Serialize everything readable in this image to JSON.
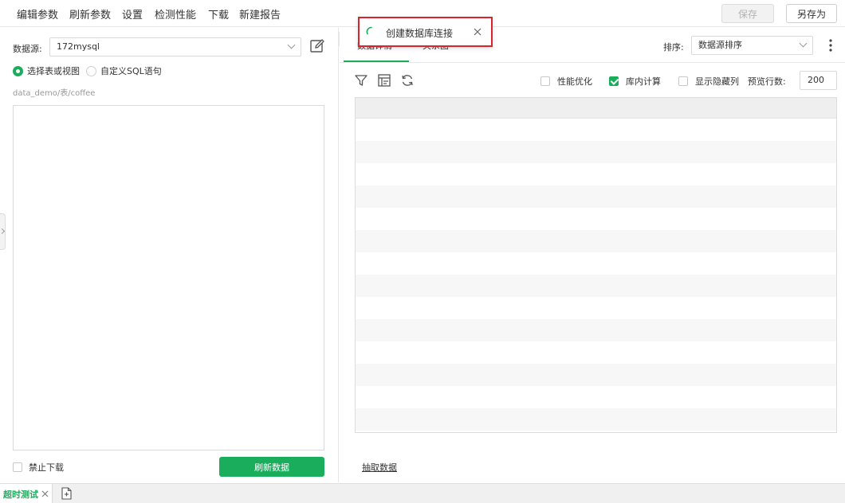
{
  "menu": {
    "items": [
      "编辑参数",
      "刷新参数",
      "设置",
      "检测性能",
      "下载",
      "新建报告"
    ],
    "save_label": "保存",
    "save_as_label": "另存为"
  },
  "left": {
    "datasource_label": "数据源:",
    "datasource_value": "172mysql",
    "radio_table": "选择表或视图",
    "radio_sql": "自定义SQL语句",
    "path": "data_demo/表/coffee",
    "disable_download": "禁止下载",
    "refresh_button": "刷新数据"
  },
  "right": {
    "tab_data": "数据详情",
    "tab_relation": "关系图",
    "sort_label": "排序:",
    "sort_value": "数据源排序",
    "opt_perf": "性能优化",
    "opt_db_calc": "库内计算",
    "opt_show_hidden": "显示隐藏列",
    "rows_label": "预览行数:",
    "rows_value": "200",
    "extract_link": "抽取数据"
  },
  "toast": {
    "text": "创建数据库连接"
  },
  "bottom": {
    "tab_label": "超时测试"
  },
  "colors": {
    "accent": "#1aad5c",
    "toast_border": "#d9232d"
  }
}
